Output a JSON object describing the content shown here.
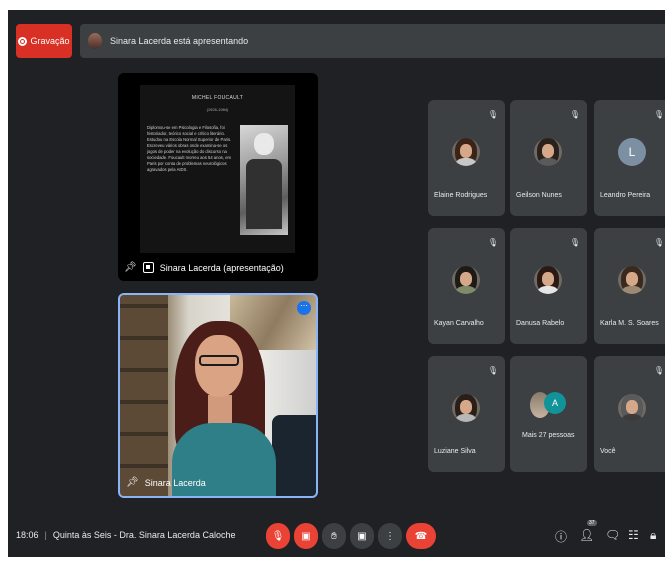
{
  "recording": {
    "label": "Gravação"
  },
  "presenting_bar": {
    "text": "Sinara Lacerda está apresentando"
  },
  "presentation": {
    "slide_title": "MICHEL FOUCAULT",
    "slide_years": "(1926-1984)",
    "slide_text": "Diplomou-se em Psicologia e Filosofia, foi historiador, teórico social e crítico literário. Estudou na Escola Normal Superior de Paris. Escreveu vários obras onde examina-se os jogos de poder na evolução do discurso na sociedade. Foucault morreu aos 54 anos, em Paris por conta de problemas neurológicos agravados pela AIDS.",
    "label": "Sinara Lacerda (apresentação)"
  },
  "speaker": {
    "name": "Sinara Lacerda"
  },
  "participants": [
    {
      "name": "Elaine Rodrigues",
      "avatar": "photo",
      "hair": "#3a2418",
      "body": "#c7c7c7"
    },
    {
      "name": "Geilson Nunes",
      "avatar": "photo",
      "hair": "#2a211c",
      "body": "#5a5a5a"
    },
    {
      "name": "Leandro Pereira",
      "avatar": "letter",
      "letter": "L"
    },
    {
      "name": "Kayan Carvalho",
      "avatar": "photo",
      "hair": "#1e1a16",
      "body": "#7e8c6a"
    },
    {
      "name": "Danusa Rabelo",
      "avatar": "photo",
      "hair": "#2b1a13",
      "body": "#e6e6e6"
    },
    {
      "name": "Karla M. S. Soares",
      "avatar": "photo",
      "hair": "#3a2a1e",
      "body": "#9c8a76"
    },
    {
      "name": "Luziane Silva",
      "avatar": "photo",
      "hair": "#2a1f18",
      "body": "#b8b8b8"
    },
    {
      "name": "Mais 27 pessoas",
      "avatar": "group",
      "letter": "A"
    },
    {
      "name": "Você",
      "avatar": "photo",
      "hair": "#5a5a5a",
      "body": "#3b3b3b"
    }
  ],
  "bottom_bar": {
    "time": "18:06",
    "meeting_title": "Quinta às Seis - Dra. Sinara Lacerda Caloche",
    "people_count": "37"
  }
}
